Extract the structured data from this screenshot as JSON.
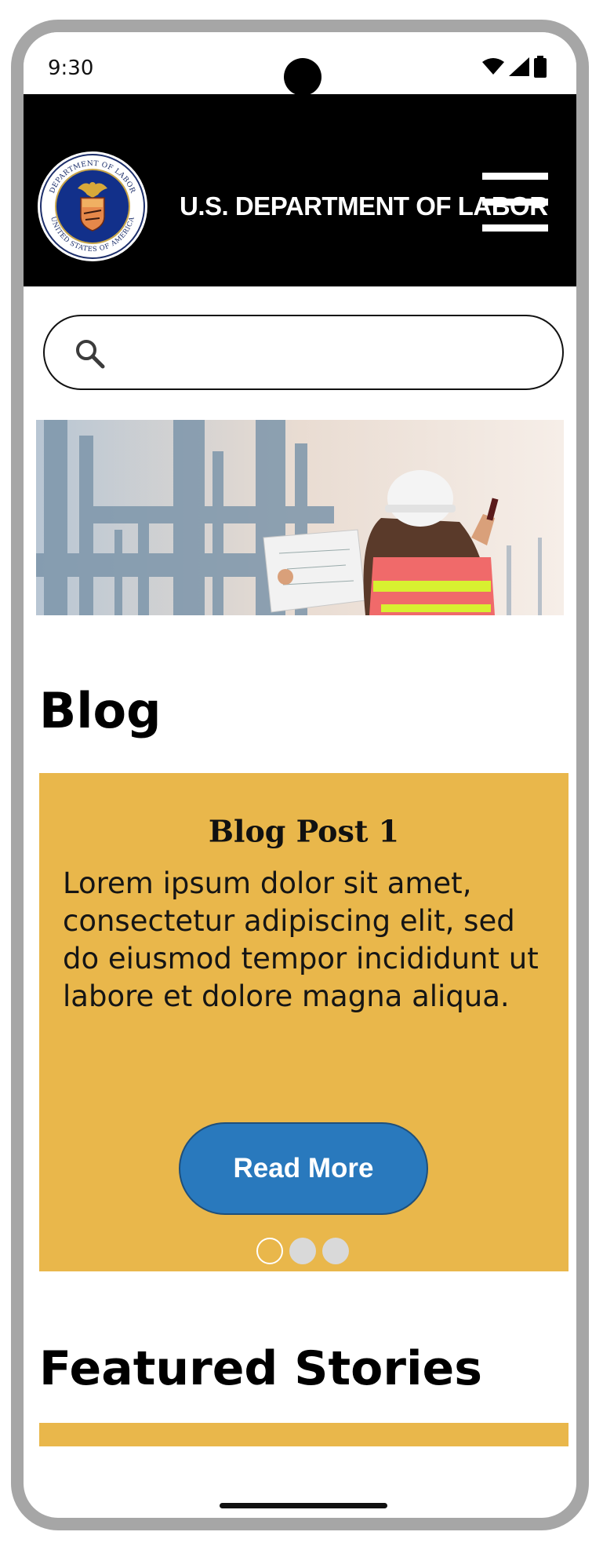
{
  "status_bar": {
    "time": "9:30",
    "icons": [
      "wifi-icon",
      "signal-icon",
      "battery-icon"
    ]
  },
  "header": {
    "logo": "department-of-labor-seal",
    "seal_text_top": "DEPARTMENT OF LABOR",
    "seal_text_bottom": "UNITED STATES OF AMERICA",
    "agency_name": "U.S. DEPARTMENT OF LABOR",
    "menu_icon": "hamburger-menu-icon",
    "background_color": "#000000"
  },
  "search": {
    "icon": "search-icon",
    "placeholder": "",
    "value": ""
  },
  "hero_image": {
    "description_icon": "worker-at-industrial-site-image"
  },
  "blog": {
    "heading": "Blog",
    "post": {
      "title": "Blog Post 1",
      "body": "Lorem ipsum dolor sit amet, consectetur adipiscing elit, sed do eiusmod tempor incididunt ut labore et dolore magna aliqua.",
      "button_label": "Read More"
    },
    "carousel": {
      "total": 3,
      "active_index": 0
    },
    "card_color": "#e9b74b",
    "button_color": "#2979bd"
  },
  "featured": {
    "heading": "Featured Stories"
  }
}
